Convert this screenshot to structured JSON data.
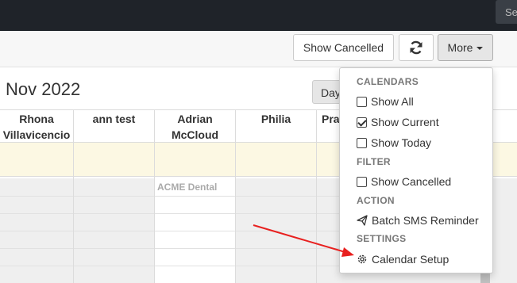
{
  "topbar": {
    "search_placeholder": "Se"
  },
  "toolbar": {
    "show_cancelled_label": "Show Cancelled",
    "refresh_icon": "refresh-icon",
    "more_label": "More"
  },
  "calendar": {
    "title": "Nov 2022",
    "view_button": "Day",
    "resources": [
      {
        "line1": "Rhona",
        "line2": "Villavicencio"
      },
      {
        "line1": "ann test",
        "line2": ""
      },
      {
        "line1": "Adrian",
        "line2": "McCloud"
      },
      {
        "line1": "Philia",
        "line2": ""
      },
      {
        "line1": "Pra",
        "line2": ""
      }
    ],
    "event_label": "ACME Dental",
    "colors": {
      "allday_bg": "#fcf8e3",
      "slot_bg": "#efefef"
    }
  },
  "dropdown": {
    "calendars_header": "CALENDARS",
    "show_all": "Show All",
    "show_current": "Show Current",
    "show_today": "Show Today",
    "filter_header": "FILTER",
    "show_cancelled": "Show Cancelled",
    "action_header": "ACTION",
    "batch_sms": "Batch SMS Reminder",
    "settings_header": "SETTINGS",
    "calendar_setup": "Calendar Setup",
    "checked": {
      "show_all": false,
      "show_current": true,
      "show_today": false,
      "show_cancelled": false
    }
  },
  "annotation": {
    "arrow_color": "#e8201f"
  }
}
